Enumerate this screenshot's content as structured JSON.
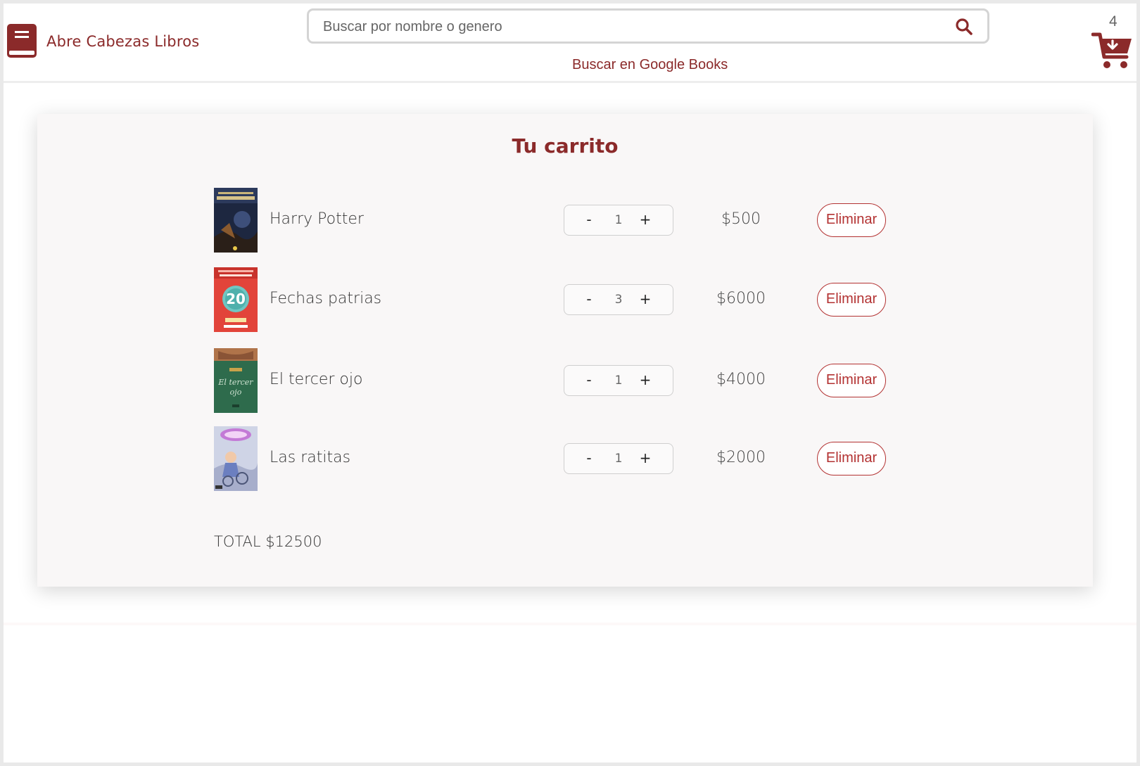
{
  "header": {
    "brand": "Abre Cabezas Libros",
    "search_placeholder": "Buscar por nombre o genero",
    "google_link": "Buscar en Google Books",
    "cart_count": "4"
  },
  "colors": {
    "brand": "#8b2a2a",
    "accent_button": "#b33232",
    "card_background": "#f9f7f7"
  },
  "cart": {
    "title": "Tu carrito",
    "items": [
      {
        "name": "Harry Potter",
        "quantity": "1",
        "price": "$500",
        "remove_label": "Eliminar",
        "minus": "-",
        "plus": "+"
      },
      {
        "name": "Fechas patrias",
        "quantity": "3",
        "price": "$6000",
        "remove_label": "Eliminar",
        "minus": "-",
        "plus": "+"
      },
      {
        "name": "El tercer ojo",
        "quantity": "1",
        "price": "$4000",
        "remove_label": "Eliminar",
        "minus": "-",
        "plus": "+"
      },
      {
        "name": "Las ratitas",
        "quantity": "1",
        "price": "$2000",
        "remove_label": "Eliminar",
        "minus": "-",
        "plus": "+"
      }
    ],
    "total": "TOTAL $12500"
  },
  "icons": [
    "book-logo-icon",
    "search-icon",
    "cart-icon"
  ]
}
